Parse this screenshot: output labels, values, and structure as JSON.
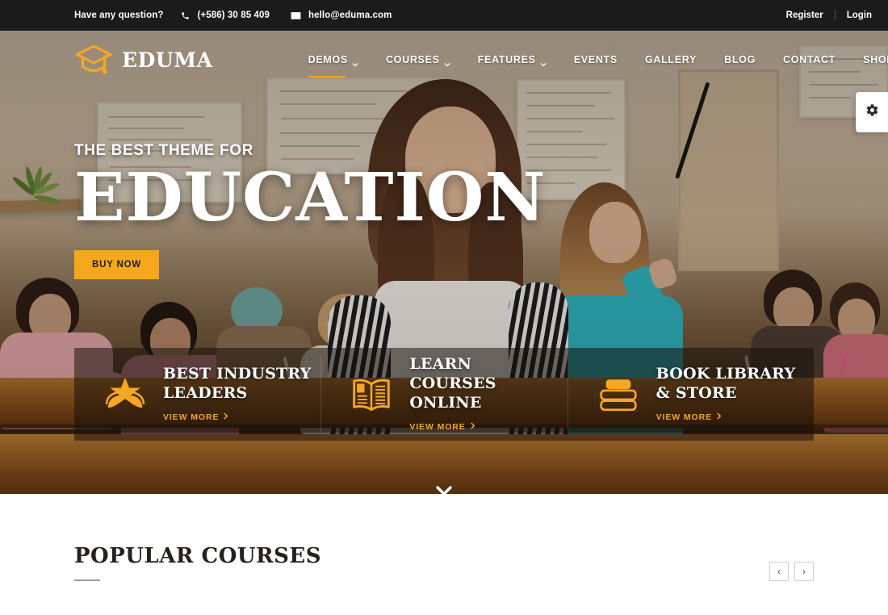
{
  "topbar": {
    "question": "Have any question?",
    "phone_icon": "phone-icon",
    "phone": "(+586) 30 85 409",
    "mail_icon": "envelope-icon",
    "email": "hello@eduma.com",
    "register": "Register",
    "login": "Login"
  },
  "header": {
    "logo_icon": "graduation-cap-icon",
    "logo_text": "EDUMA",
    "search_icon": "search-icon",
    "nav": [
      {
        "label": "DEMOS",
        "has_caret": true,
        "active": true
      },
      {
        "label": "COURSES",
        "has_caret": true,
        "active": false
      },
      {
        "label": "FEATURES",
        "has_caret": true,
        "active": false
      },
      {
        "label": "EVENTS",
        "has_caret": false,
        "active": false
      },
      {
        "label": "GALLERY",
        "has_caret": false,
        "active": false
      },
      {
        "label": "BLOG",
        "has_caret": false,
        "active": false
      },
      {
        "label": "CONTACT",
        "has_caret": false,
        "active": false
      },
      {
        "label": "SHOP",
        "has_caret": false,
        "active": false
      }
    ]
  },
  "hero": {
    "kicker": "THE BEST THEME FOR",
    "headline": "EDUCATION",
    "cta_label": "BUY NOW",
    "scroll_icon": "chevron-down-icon"
  },
  "features": [
    {
      "icon": "star-wreath-icon",
      "title": "BEST INDUSTRY LEADERS",
      "more": "VIEW MORE"
    },
    {
      "icon": "open-book-icon",
      "title": "LEARN COURSES ONLINE",
      "more": "VIEW MORE"
    },
    {
      "icon": "book-stack-icon",
      "title": "BOOK LIBRARY & STORE",
      "more": "VIEW MORE"
    }
  ],
  "settings_tab": {
    "icon": "gear-icon"
  },
  "section": {
    "title": "POPULAR COURSES",
    "prev_label": "‹",
    "next_label": "›"
  },
  "colors": {
    "accent_gold": "#f5a623",
    "button_gold": "#f5a81c",
    "topbar_bg": "#1b1b1b",
    "text_dark": "#26211c"
  }
}
